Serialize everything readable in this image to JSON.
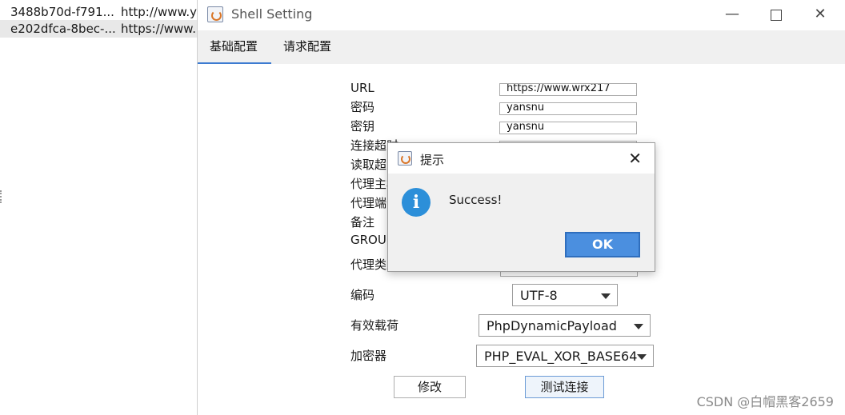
{
  "background_list": {
    "rows": [
      {
        "id": "3488b70d-f791...",
        "url": "http://www.y"
      },
      {
        "id": "e202dfca-8bec-...",
        "url": "https://www."
      }
    ]
  },
  "window": {
    "title": "Shell Setting",
    "controls": {
      "minimize": "—",
      "close": "✕"
    },
    "tabs": [
      {
        "label": "基础配置"
      },
      {
        "label": "请求配置"
      }
    ]
  },
  "form": {
    "labels": {
      "url": "URL",
      "password": "密码",
      "key": "密钥",
      "connect_timeout": "连接超时",
      "read_timeout": "读取超时",
      "proxy_host": "代理主机",
      "proxy_port": "代理端口",
      "remark": "备注",
      "group": "GROUP",
      "proxy_type": "代理类型",
      "encoding": "编码",
      "payload": "有效载荷",
      "encryptor": "加密器"
    },
    "values": {
      "url": "https://www.wrx217",
      "password": "yansnu",
      "key": "yansnu"
    },
    "encoding_selected": "UTF-8",
    "payload_selected": "PhpDynamicPayload",
    "encryptor_selected": "PHP_EVAL_XOR_BASE64",
    "buttons": {
      "modify": "修改",
      "test_connection": "测试连接"
    }
  },
  "dialog": {
    "title": "提示",
    "message": "Success!",
    "ok_label": "OK",
    "close_glyph": "✕",
    "info_glyph": "i"
  },
  "watermark": "CSDN @白帽黑客2659"
}
